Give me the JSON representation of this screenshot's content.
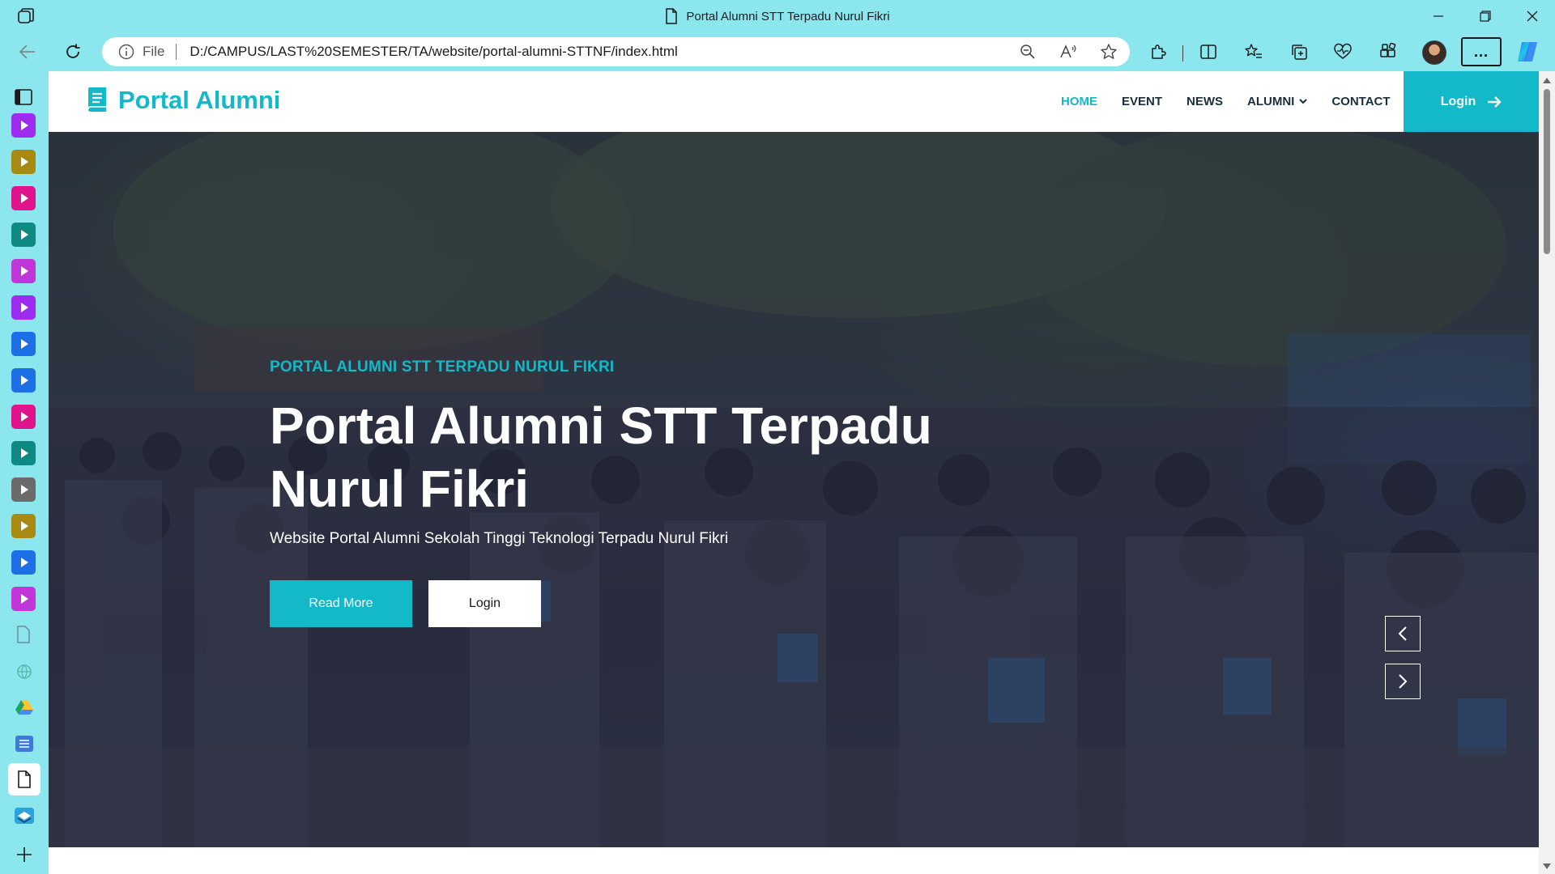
{
  "window": {
    "title": "Portal Alumni STT Terpadu Nurul Fikri"
  },
  "address_bar": {
    "scheme_label": "File",
    "url": "D:/CAMPUS/LAST%20SEMESTER/TA/website/portal-alumni-STTNF/index.html"
  },
  "toolbar": {
    "more_label": "..."
  },
  "sidebar": {
    "items": [
      {
        "icon": "media-app-icon",
        "color": "#9d2bf0"
      },
      {
        "icon": "media-app-icon",
        "color": "#a88a12"
      },
      {
        "icon": "media-app-icon",
        "color": "#e0138c"
      },
      {
        "icon": "media-app-icon",
        "color": "#0f8a82"
      },
      {
        "icon": "media-app-icon",
        "color": "#c036d9"
      },
      {
        "icon": "media-app-icon",
        "color": "#9d2bf0"
      },
      {
        "icon": "media-app-icon",
        "color": "#1d6fe6"
      },
      {
        "icon": "media-app-icon",
        "color": "#1d6fe6"
      },
      {
        "icon": "media-app-icon",
        "color": "#e0138c"
      },
      {
        "icon": "media-app-icon",
        "color": "#0f8a82"
      },
      {
        "icon": "media-app-icon",
        "color": "#6b6b6b"
      },
      {
        "icon": "media-app-icon",
        "color": "#a88a12"
      },
      {
        "icon": "media-app-icon",
        "color": "#1d6fe6"
      },
      {
        "icon": "media-app-icon",
        "color": "#c036d9"
      }
    ]
  },
  "navbar": {
    "brand": "Portal Alumni",
    "links": {
      "home": "HOME",
      "event": "EVENT",
      "news": "NEWS",
      "alumni": "ALUMNI",
      "contact": "CONTACT"
    },
    "login": "Login"
  },
  "hero": {
    "kicker": "PORTAL ALUMNI STT TERPADU NURUL FIKRI",
    "title": "Portal Alumni STT Terpadu Nurul Fikri",
    "subtitle": "Website Portal Alumni Sekolah Tinggi Teknologi Terpadu Nurul Fikri",
    "read_more": "Read More",
    "login": "Login"
  },
  "colors": {
    "accent": "#13b9c9",
    "chrome": "#8ce6ee",
    "nav_text": "#1a2e3b"
  }
}
